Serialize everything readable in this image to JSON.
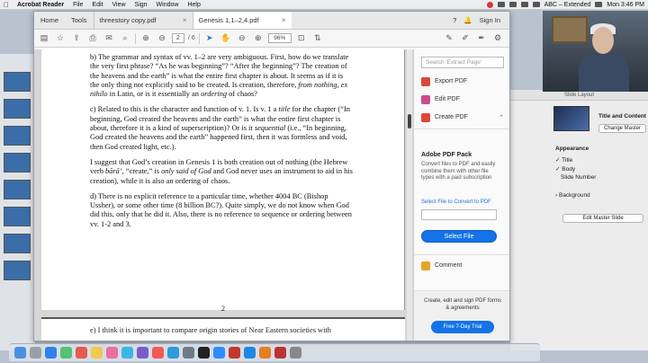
{
  "menubar": {
    "apple": "",
    "items": [
      "Acrobat Reader",
      "File",
      "Edit",
      "View",
      "Sign",
      "Window",
      "Help"
    ],
    "input_source": "ABC – Extended",
    "clock": "Mon 3:46 PM"
  },
  "tabs": {
    "home": "Home",
    "tools": "Tools",
    "doc1": "threestory copy.pdf",
    "doc2": "Genesis 1,1–2,4.pdf",
    "close": "×",
    "sign_in": "Sign In"
  },
  "toolbar": {
    "page_current": "2",
    "page_total": "/ 6",
    "zoom": "96%"
  },
  "document": {
    "paragraphs": [
      "b) The grammar and syntax of vv. 1–2 are very ambiguous. First, how do we translate the very first phrase? “As he was beginning”? “After the beginning”? The creation of the heavens and the earth” is what the entire first chapter is about, therefore it is a kind of superscription)? Or is it sequential (i.e., “In beginning, God created the heavens and the earth” happened first, then it was formless and void, then God created light, etc.).",
      "c) Related to this is the character and function of v. 1. Is v. 1 a title for the chapter (“In beginning, God created the heavens and the earth” is what the entire first chapter is about, therefore it is a kind of superscription)? Or is it sequential (i.e., “In beginning, God created the heavens and the earth” happened first, then it was formless and void, then God created light, etc.).",
      "I suggest that God’s creation in Genesis 1 is both creation out of nothing (the Hebrew verb bārā’, “create,” is only said of God and God never uses an instrument to aid in his creation), while it is also an ordering of chaos.",
      "d) There is no explicit reference to a particular time, whether 4004 BC (Bishop Ussher), or some other time (8 billion BC?). Quite simply, we do not know when God did this, only that he did it. Also, there is no reference to sequence or ordering between vv. 1-2 and 3."
    ],
    "page_number": "2",
    "next_page_text": "e) I think it is important to compare origin stories of Near Eastern societies with"
  },
  "tools_pane": {
    "search_placeholder": "Search 'Extract Page'",
    "export_pdf": "Export PDF",
    "edit_pdf": "Edit PDF",
    "create_pdf": "Create PDF",
    "pack_title": "Adobe PDF Pack",
    "pack_desc": "Convert files to PDF and easily combine them with other file types with a paid subscription",
    "select_label": "Select File to Convert to PDF",
    "select_button": "Select File",
    "comment": "Comment",
    "promo_text": "Create, edit and sign PDF forms & agreements",
    "trial_button": "Free 7-Day Trial"
  },
  "keynote_panel": {
    "header": "Slide Layout",
    "title_content": "Title and Content",
    "change_master": "Change Master",
    "appearance": "Appearance",
    "title": "Title",
    "body": "Body",
    "slide_number": "Slide Number",
    "background": "Background",
    "edit_master": "Edit Master Slide"
  },
  "colors": {
    "accent": "#1473e6",
    "export_icon": "#d64a3b",
    "edit_icon": "#c94d8f",
    "create_icon": "#e0453a",
    "comment_icon": "#e6a42a"
  }
}
